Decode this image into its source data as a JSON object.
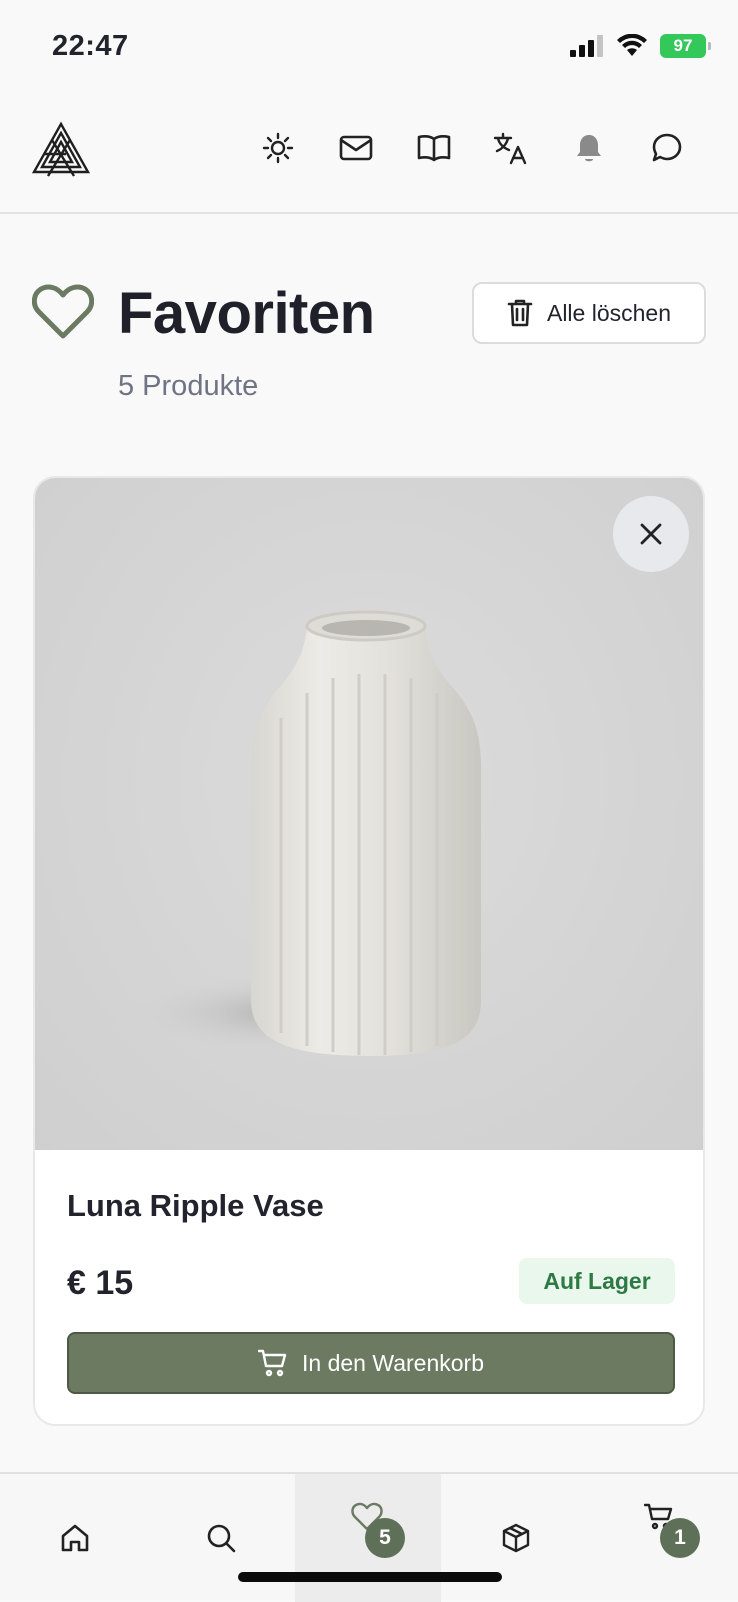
{
  "status_bar": {
    "time": "22:47",
    "battery": "97",
    "icons": [
      "signal-icon",
      "wifi-icon",
      "battery-charging-icon"
    ]
  },
  "header": {
    "icons": [
      "theme-sun-icon",
      "mail-icon",
      "book-icon",
      "translate-icon",
      "bell-icon",
      "chat-icon"
    ]
  },
  "page": {
    "title": "Favoriten",
    "count": "5 Produkte",
    "clear_all_label": "Alle löschen"
  },
  "products": [
    {
      "name": "Luna Ripple Vase",
      "price": "€ 15",
      "stock": "Auf Lager",
      "add_to_cart_label": "In den Warenkorb"
    }
  ],
  "bottom_nav": {
    "items": [
      "home",
      "search",
      "favorites",
      "products",
      "cart"
    ],
    "favorites_badge": "5",
    "cart_badge": "1"
  },
  "colors": {
    "accent": "#6b7a60",
    "stock_bg": "#eaf7ec",
    "stock_text": "#2e7a45",
    "badge": "#5e7057"
  }
}
